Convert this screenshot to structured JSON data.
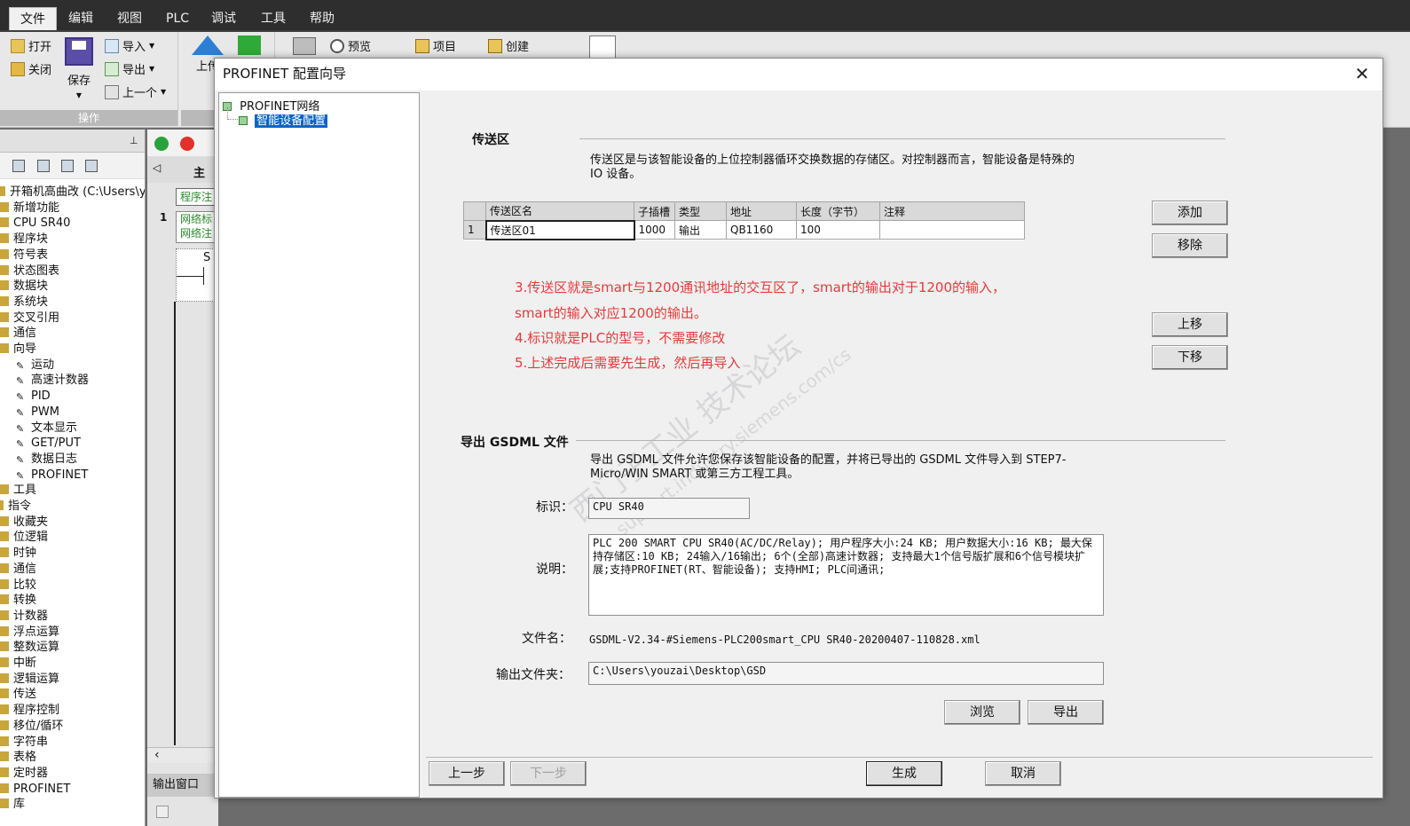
{
  "menu": {
    "items": [
      "文件",
      "编辑",
      "视图",
      "PLC",
      "调试",
      "工具",
      "帮助"
    ]
  },
  "ribbon": {
    "open_label": "打开",
    "close_label": "关闭",
    "save_label": "保存",
    "import_label": "导入",
    "export_label": "导出",
    "prev_label": "上一个",
    "group_label": "操作",
    "upload_label": "上传",
    "preview_label": "预览",
    "project_label": "项目",
    "create_label": "创建"
  },
  "left_tree": {
    "project_path": "开箱机高曲改 (C:\\Users\\youze",
    "items": [
      "新增功能",
      "CPU SR40",
      "程序块",
      "符号表",
      "状态图表",
      "数据块",
      "系统块",
      "交叉引用",
      "通信",
      "向导"
    ],
    "wizard_items": [
      "运动",
      "高速计数器",
      "PID",
      "PWM",
      "文本显示",
      "GET/PUT",
      "数据日志",
      "PROFINET"
    ],
    "tools_label": "工具",
    "instr_label": "指令",
    "instr_items": [
      "收藏夹",
      "位逻辑",
      "时钟",
      "通信",
      "比较",
      "转换",
      "计数器",
      "浮点运算",
      "整数运算",
      "中断",
      "逻辑运算",
      "传送",
      "程序控制",
      "移位/循环",
      "字符串",
      "表格",
      "定时器",
      "PROFINET",
      "库"
    ]
  },
  "mid": {
    "tab_label": "主",
    "comment_label": "程序注",
    "net_num": "1",
    "net_title_1": "网络标",
    "net_title_2": "网络注",
    "contact": "S",
    "output_window": "输出窗口"
  },
  "dialog": {
    "title": "PROFINET 配置向导",
    "close_glyph": "✕",
    "tree_root": "PROFINET网络",
    "tree_child": "智能设备配置",
    "transfer": {
      "heading": "传送区",
      "desc": "传送区是与该智能设备的上位控制器循环交换数据的存储区。对控制器而言，智能设备是特殊的 IO 设备。",
      "columns": [
        "传送区名",
        "子插槽",
        "类型",
        "地址",
        "长度（字节）",
        "注释"
      ],
      "rows": [
        {
          "num": "1",
          "name": "传送区01",
          "slot": "1000",
          "type": "输出",
          "addr": "QB1160",
          "len": "100",
          "note": ""
        }
      ],
      "add_button": "添加",
      "remove_button": "移除",
      "up_button": "上移",
      "down_button": "下移"
    },
    "notes": [
      "3.传送区就是smart与1200通讯地址的交互区了，smart的输出对于1200的输入，",
      "smart的输入对应1200的输出。",
      "4.标识就是PLC的型号，不需要修改",
      "5.上述完成后需要先生成，然后再导入"
    ],
    "watermark": {
      "cn": "西门子工业 技术论坛",
      "url": "support.industry.siemens.com/cs"
    },
    "gsdml": {
      "heading": "导出 GSDML 文件",
      "desc": "导出 GSDML 文件允许您保存该智能设备的配置，并将已导出的 GSDML 文件导入到 STEP7-Micro/WIN SMART 或第三方工程工具。",
      "id_label": "标识：",
      "id_value": "CPU SR40",
      "desc_label": "说明：",
      "desc_value": "PLC 200 SMART CPU SR40(AC/DC/Relay); 用户程序大小:24 KB; 用户数据大小:16 KB; 最大保持存储区:10 KB; 24输入/16输出; 6个(全部)高速计数器; 支持最大1个信号版扩展和6个信号模块扩展;支持PROFINET(RT、智能设备); 支持HMI; PLC间通讯;",
      "file_label": "文件名：",
      "file_value": "GSDML-V2.34-#Siemens-PLC200smart_CPU SR40-20200407-110828.xml",
      "folder_label": "输出文件夹：",
      "folder_value": "C:\\Users\\youzai\\Desktop\\GSD",
      "browse_button": "浏览",
      "export_button": "导出"
    },
    "footer": {
      "prev_button": "上一步",
      "next_button": "下一步",
      "generate_button": "生成",
      "cancel_button": "取消"
    }
  }
}
